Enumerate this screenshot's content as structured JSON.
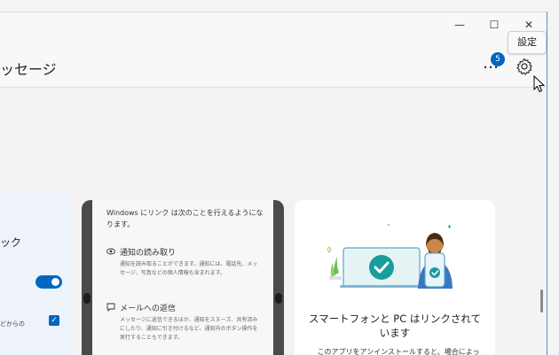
{
  "window": {
    "title": "ッセージ",
    "minimize_glyph": "—",
    "maximize_glyph": "☐",
    "close_glyph": "✕"
  },
  "header": {
    "notification_count": "5",
    "more_glyph": "…",
    "settings_tooltip": "設定"
  },
  "left_card": {
    "label": "ック",
    "checkbox_text": "どからの"
  },
  "phone_card": {
    "intro": "Windows にリンク は次のことを行えるようになります。",
    "features": [
      {
        "icon": "eye-icon",
        "title": "通知の読み取り",
        "desc": "通知を読み取ることができます。通知には、電話先、メッセージ、写真などの個人情報も含まれます。"
      },
      {
        "icon": "message-icon",
        "title": "メールへの返信",
        "desc": "メッセージに返信できるほか、通知をスヌーズ、共有済みにしたり、通知に引き付けるなど、通知内のボタン操作を実行することもできます。"
      }
    ]
  },
  "info_card": {
    "title": "スマートフォンと PC はリンクされています",
    "desc": "このアプリをアンインストールすると、場合によって、スマートフォンと PC のリンクが"
  },
  "colors": {
    "accent": "#0067c0",
    "card_dark": "#4a4a4a",
    "teal": "#1a9c9c"
  }
}
